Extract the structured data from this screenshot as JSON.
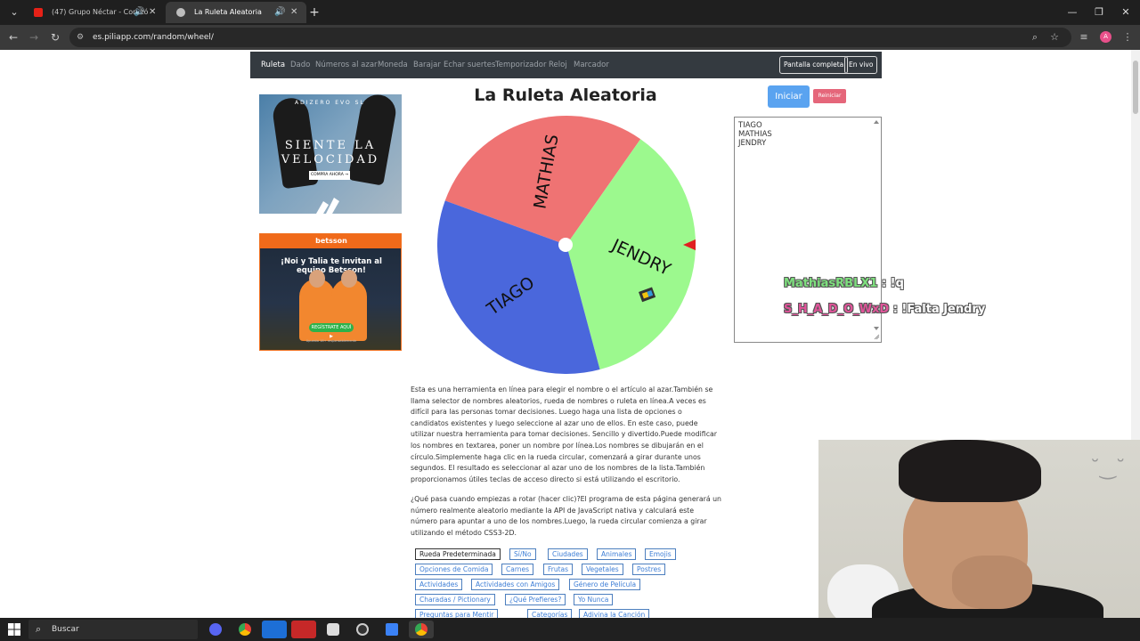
{
  "browser": {
    "tabs": [
      {
        "title": "(47) Grupo Néctar - Corazó",
        "active": false
      },
      {
        "title": "La Ruleta Aleatoria",
        "active": true
      }
    ],
    "new_tab": "+",
    "url": "es.piliapp.com/random/wheel/",
    "profile_initial": "A"
  },
  "site_nav": {
    "links": [
      "Ruleta",
      "Dado",
      "Números al azar",
      "Moneda",
      "Barajar",
      "Echar suertes",
      "Temporizador",
      "Reloj",
      "Marcador"
    ],
    "fullscreen": "Pantalla completa",
    "live": "En vivo"
  },
  "ads": {
    "ad1": {
      "top": "ADIZERO EVO SL",
      "line1": "SIENTE LA",
      "line2": "VELOCIDAD",
      "cta": "COMPRA AHORA →"
    },
    "ad2": {
      "brand": "betsson",
      "headline": "¡Noi y Talia te invitan al equipo Betsson!",
      "cta": "REGÍSTRATE AQUÍ ▶",
      "fine": "Apuesta 18+ responsablemente"
    }
  },
  "wheel": {
    "title": "La Ruleta Aleatoria",
    "start": "Iniciar",
    "reset": "Reiniciar",
    "segments": [
      {
        "name": "MATHIAS",
        "color": "#ef7373"
      },
      {
        "name": "JENDRY",
        "color": "#9cf98e"
      },
      {
        "name": "TIAGO",
        "color": "#4a67dc"
      }
    ],
    "pointer_color": "#e02020",
    "names_list": [
      "TIAGO",
      "MATHIAS",
      "JENDRY"
    ]
  },
  "chat": [
    {
      "user": "MathiasRBLX1",
      "message": " : !q"
    },
    {
      "user": "S_H_A_D_O_WxD",
      "message": " : !Falta Jendry"
    }
  ],
  "description": {
    "p1": "Esta es una herramienta en línea para elegir el nombre o el artículo al azar.También se llama selector de nombres aleatorios, rueda de nombres o ruleta en línea.A veces es difícil para las personas tomar decisiones. Luego haga una lista de opciones o candidatos existentes y luego seleccione al azar uno de ellos. En este caso, puede utilizar nuestra herramienta para tomar decisiones. Sencillo y divertido.Puede modificar los nombres en textarea, poner un nombre por línea.Los nombres se dibujarán en el círculo.Simplemente haga clic en la rueda circular, comenzará a girar durante unos segundos. El resultado es seleccionar al azar uno de los nombres de la lista.También proporcionamos útiles teclas de acceso directo si está utilizando el escritorio.",
    "p2": "¿Qué pasa cuando empiezas a rotar (hacer clic)?El programa de esta página generará un número realmente aleatorio mediante la API de JavaScript nativa y calculará este número para apuntar a uno de los nombres.Luego, la rueda circular comienza a girar utilizando el método CSS3-2D."
  },
  "presets": [
    "Rueda Predeterminada",
    "Sí/No",
    "Ciudades",
    "Animales",
    "Emojis",
    "Opciones de Comida",
    "Carnes",
    "Frutas",
    "Vegetales",
    "Postres",
    "Actividades",
    "Actividades con Amigos",
    "Género de Película",
    "Charadas / Pictionary",
    "¿Qué Prefieres?",
    "Yo Nunca",
    "Preguntas para Mentir",
    "Categorías",
    "Adivina la Canción"
  ],
  "taskbar": {
    "search": "Buscar"
  }
}
